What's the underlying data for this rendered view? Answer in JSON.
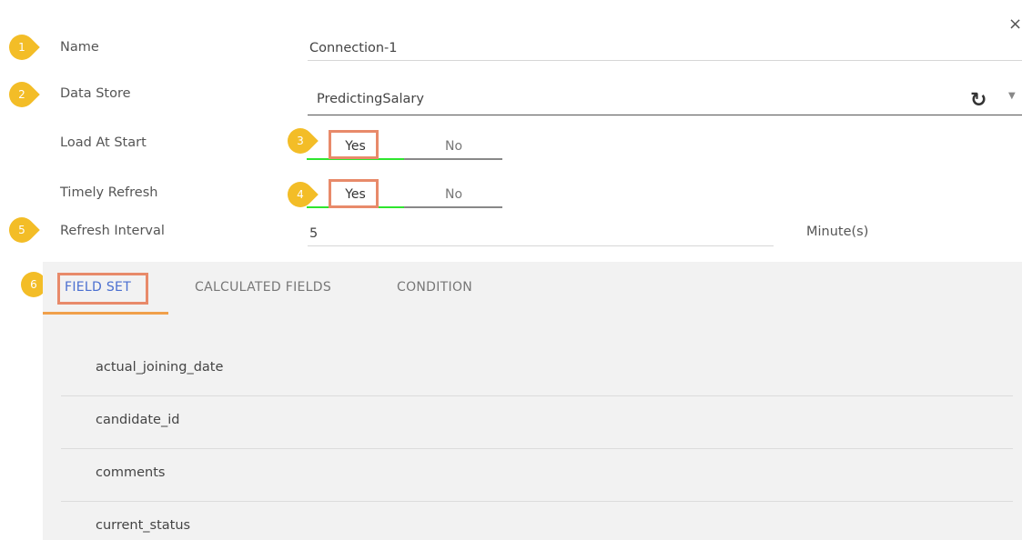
{
  "dialog": {
    "close_glyph": "×"
  },
  "form": {
    "name": {
      "label": "Name",
      "value": "Connection-1"
    },
    "data_store": {
      "label": "Data Store",
      "value": "PredictingSalary",
      "refresh_icon": "refresh-icon",
      "dropdown_glyph": "▼"
    },
    "load_at_start": {
      "label": "Load At Start",
      "yes": "Yes",
      "no": "No",
      "selected": "Yes"
    },
    "timely_refresh": {
      "label": "Timely Refresh",
      "yes": "Yes",
      "no": "No",
      "selected": "Yes"
    },
    "refresh_interval": {
      "label": "Refresh Interval",
      "value": "5",
      "unit": "Minute(s)"
    }
  },
  "markers": [
    "1",
    "2",
    "3",
    "4",
    "5",
    "6"
  ],
  "tabs": [
    {
      "label": "FIELD SET",
      "active": true
    },
    {
      "label": "CALCULATED FIELDS",
      "active": false
    },
    {
      "label": "CONDITION",
      "active": false
    }
  ],
  "fields": [
    "actual_joining_date",
    "candidate_id",
    "comments",
    "current_status"
  ],
  "colors": {
    "marker": "#f3bd27",
    "highlight": "#e88a6a",
    "toggle_on": "#2ee52e",
    "tab_active": "#4a6fd0",
    "tab_underline": "#f0a04b"
  }
}
